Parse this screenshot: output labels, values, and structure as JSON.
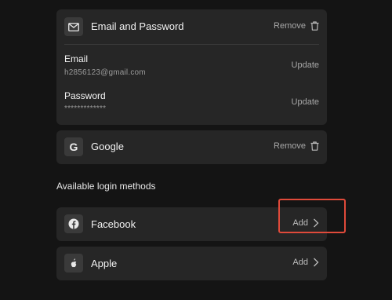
{
  "email_password": {
    "title": "Email and Password",
    "remove_label": "Remove",
    "email_label": "Email",
    "email_value": "h2856123@gmail.com",
    "email_update_label": "Update",
    "password_label": "Password",
    "password_value": "*************",
    "password_update_label": "Update"
  },
  "google": {
    "title": "Google",
    "remove_label": "Remove"
  },
  "available": {
    "section_title": "Available login methods",
    "methods": [
      {
        "title": "Facebook",
        "action_label": "Add"
      },
      {
        "title": "Apple",
        "action_label": "Add"
      }
    ]
  },
  "colors": {
    "background": "#141414",
    "card": "#262626",
    "highlight": "#e04a3a"
  }
}
